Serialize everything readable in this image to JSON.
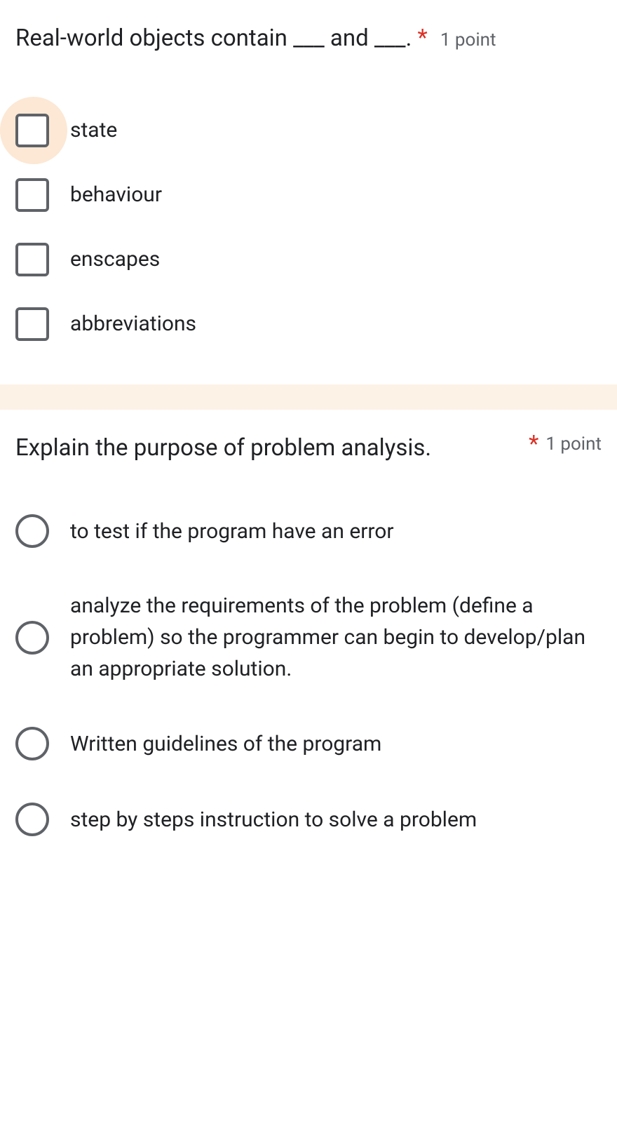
{
  "q1": {
    "title": "Real-world objects contain ___ and ___.",
    "required": "*",
    "points": "1 point",
    "options": [
      {
        "label": "state"
      },
      {
        "label": "behaviour"
      },
      {
        "label": "enscapes"
      },
      {
        "label": "abbreviations"
      }
    ]
  },
  "q2": {
    "title": "Explain the purpose of problem analysis.",
    "required": "*",
    "points": "1 point",
    "options": [
      {
        "label": "to test if the program have an error"
      },
      {
        "label": "analyze the requirements of the problem (define a problem) so the programmer can begin to develop/plan an appropriate solution."
      },
      {
        "label": "Written guidelines of the program"
      },
      {
        "label": "step by steps instruction to solve a problem"
      }
    ]
  }
}
